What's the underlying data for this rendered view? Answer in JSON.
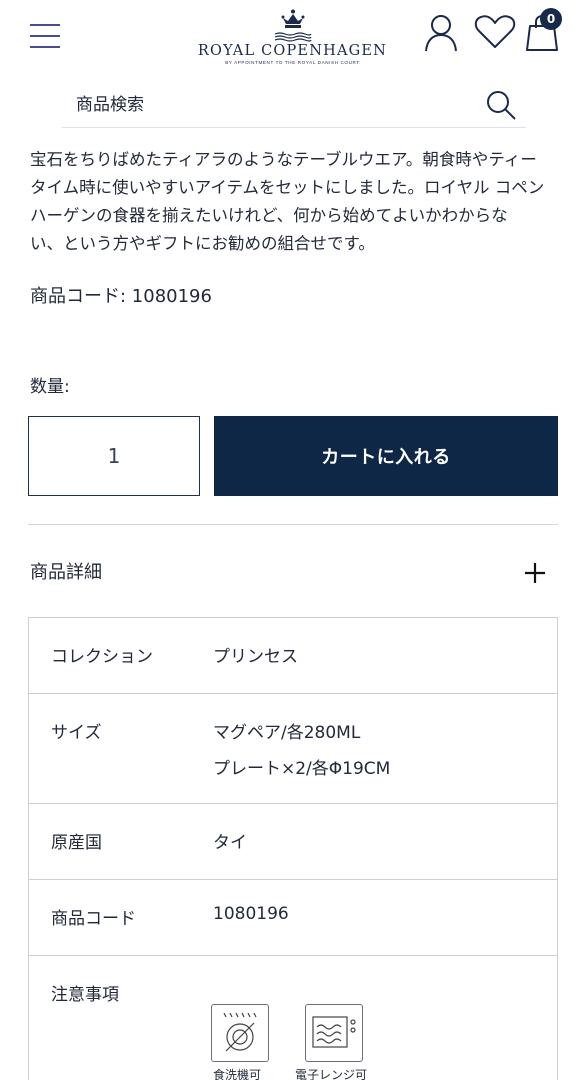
{
  "header": {
    "brand_name": "ROYAL COPENHAGEN",
    "brand_tagline": "BY APPOINTMENT TO THE ROYAL DANISH COURT",
    "cart_count": "0"
  },
  "search": {
    "placeholder": "商品検索"
  },
  "product": {
    "description_lines": [
      "宝石をちりばめたティアラのようなテーブルウエア。朝食時やティー",
      "タイム時に使いやすいアイテムをセットにしました。ロイヤル コペン",
      "ハーゲンの食器を揃えたいけれど、何から始めてよいかわからな",
      "い、という方やギフトにお勧めの組合せです。"
    ],
    "code_label": "商品コード: 1080196",
    "quantity_label": "数量:",
    "quantity_value": "1",
    "add_to_cart_label": "カートに入れる"
  },
  "details": {
    "title": "商品詳細",
    "rows": [
      {
        "key": "コレクション",
        "values": [
          "プリンセス"
        ]
      },
      {
        "key": "サイズ",
        "values": [
          "マグペア/各280ML",
          "プレート×2/各Φ19CM"
        ]
      },
      {
        "key": "原産国",
        "values": [
          "タイ"
        ]
      },
      {
        "key": "商品コード",
        "values": [
          "1080196"
        ]
      },
      {
        "key": "注意事項",
        "values": []
      }
    ],
    "care_icons": [
      {
        "icon": "dishwasher-safe-icon",
        "label": "食洗機可"
      },
      {
        "icon": "microwave-safe-icon",
        "label": "電子レンジ可"
      }
    ]
  },
  "colors": {
    "navy": "#0f2747",
    "text": "#222a3a",
    "menu_accent": "#4a4c8f"
  }
}
